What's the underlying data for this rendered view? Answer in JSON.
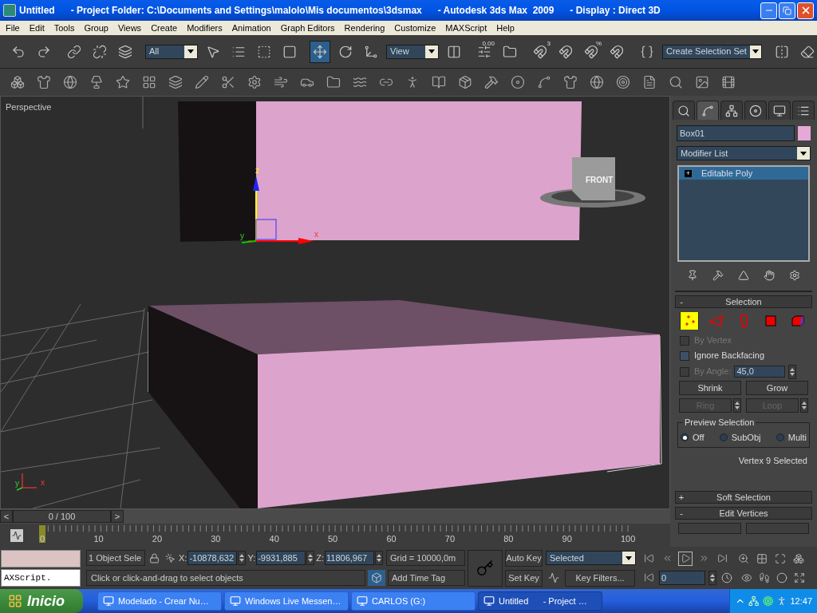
{
  "window": {
    "title": "Untitled      - Project Folder: C:\\Documents and Settings\\malolo\\Mis documentos\\3dsmax      - Autodesk 3ds Max  2009      - Display : Direct 3D"
  },
  "menu": [
    "File",
    "Edit",
    "Tools",
    "Group",
    "Views",
    "Create",
    "Modifiers",
    "Animation",
    "Graph Editors",
    "Rendering",
    "Customize",
    "MAXScript",
    "Help"
  ],
  "main_toolbar": [
    {
      "kind": "button",
      "selected": false
    },
    {
      "kind": "button",
      "selected": false
    },
    {
      "kind": "separator"
    },
    {
      "kind": "button",
      "selected": false
    },
    {
      "kind": "button",
      "selected": false
    },
    {
      "kind": "button",
      "selected": false
    },
    {
      "kind": "separator"
    },
    {
      "kind": "dropdown",
      "value": "All"
    },
    {
      "kind": "button",
      "selected": false
    },
    {
      "kind": "button",
      "selected": false
    },
    {
      "kind": "button",
      "selected": false
    },
    {
      "kind": "button",
      "selected": false
    },
    {
      "kind": "separator"
    },
    {
      "kind": "button",
      "selected": true
    },
    {
      "kind": "button",
      "selected": false
    },
    {
      "kind": "button",
      "selected": false
    },
    {
      "kind": "dropdown",
      "value": "View"
    },
    {
      "kind": "button",
      "selected": false
    },
    {
      "kind": "separator"
    },
    {
      "kind": "button",
      "selected": false,
      "label": "0.00"
    },
    {
      "kind": "button",
      "selected": false
    },
    {
      "kind": "separator"
    },
    {
      "kind": "button",
      "selected": false,
      "label": "3"
    },
    {
      "kind": "button",
      "selected": false
    },
    {
      "kind": "button",
      "selected": false,
      "label": "%"
    },
    {
      "kind": "button",
      "selected": false
    },
    {
      "kind": "separator"
    },
    {
      "kind": "button",
      "selected": false
    },
    {
      "kind": "dropdown",
      "value": "Create Selection Set"
    },
    {
      "kind": "separator"
    },
    {
      "kind": "button",
      "selected": false
    },
    {
      "kind": "button",
      "selected": false
    }
  ],
  "viewport": {
    "label": "Perspective",
    "view_cube": "FRONT",
    "gizmo_axes": [
      "z",
      "y",
      "x"
    ],
    "corner_axes": [
      "y",
      "x"
    ]
  },
  "command_panel": {
    "tabs": [
      {
        "selected": false
      },
      {
        "selected": true
      },
      {
        "selected": false
      },
      {
        "selected": false
      },
      {
        "selected": false
      },
      {
        "selected": false
      }
    ],
    "object_name": "Box01",
    "modifier_list": "Modifier List",
    "stack": [
      {
        "toggle": "+",
        "label": "Editable Poly",
        "selected": true
      }
    ],
    "rollouts": [
      {
        "toggle": "-",
        "title": "Selection"
      },
      {
        "toggle": "+",
        "title": "Soft Selection"
      },
      {
        "toggle": "-",
        "title": "Edit Vertices"
      }
    ],
    "selection": {
      "levels": [
        {
          "selected": true
        },
        {
          "selected": false
        },
        {
          "selected": false
        },
        {
          "selected": false
        },
        {
          "selected": false
        }
      ],
      "checkboxes": [
        {
          "label": "By Vertex",
          "checked": false,
          "disabled": true
        },
        {
          "label": "Ignore Backfacing",
          "checked": false,
          "disabled": false
        }
      ],
      "by_angle": {
        "label": "By Angle:",
        "value": "45,0",
        "checked": false,
        "disabled": true
      },
      "buttons": [
        {
          "label": "Shrink",
          "disabled": false
        },
        {
          "label": "Grow",
          "disabled": false
        },
        {
          "label": "Ring",
          "disabled": true
        },
        {
          "label": "Loop",
          "disabled": true
        }
      ],
      "preview": {
        "title": "Preview Selection",
        "options": [
          {
            "label": "Off",
            "selected": true
          },
          {
            "label": "SubObj",
            "selected": false
          },
          {
            "label": "Multi",
            "selected": false
          }
        ]
      },
      "status": "Vertex 9 Selected"
    }
  },
  "time_slider": {
    "prev": "<",
    "position": "0 / 100",
    "next": ">"
  },
  "track_bar": {
    "labels": [
      "0",
      "10",
      "20",
      "30",
      "40",
      "50",
      "60",
      "70",
      "80",
      "90",
      "100"
    ]
  },
  "status_bar": {
    "listener_value": "AXScript.",
    "selection_info": "1 Object Sele",
    "coords": [
      {
        "axis": "X:",
        "value": "-10878,632"
      },
      {
        "axis": "Y:",
        "value": "-9931,885"
      },
      {
        "axis": "Z:",
        "value": "11806,967"
      }
    ],
    "grid": "Grid = 10000,0m",
    "prompt": "Click or click-and-drag to select objects",
    "add_time_tag": "Add Time Tag",
    "auto_key": "Auto Key",
    "set_key": "Set Key",
    "key_mode": "Selected",
    "key_filters": "Key Filters...",
    "frame": "0"
  },
  "taskbar": {
    "start": "Inicio",
    "tasks": [
      {
        "label": "Modelado - Crear Nu…",
        "selected": false
      },
      {
        "label": "Windows Live Messen…",
        "selected": false
      },
      {
        "label": "CARLOS (G:)",
        "selected": false
      },
      {
        "label": "Untitled      - Project …",
        "selected": true
      }
    ],
    "clock": "12:47"
  }
}
